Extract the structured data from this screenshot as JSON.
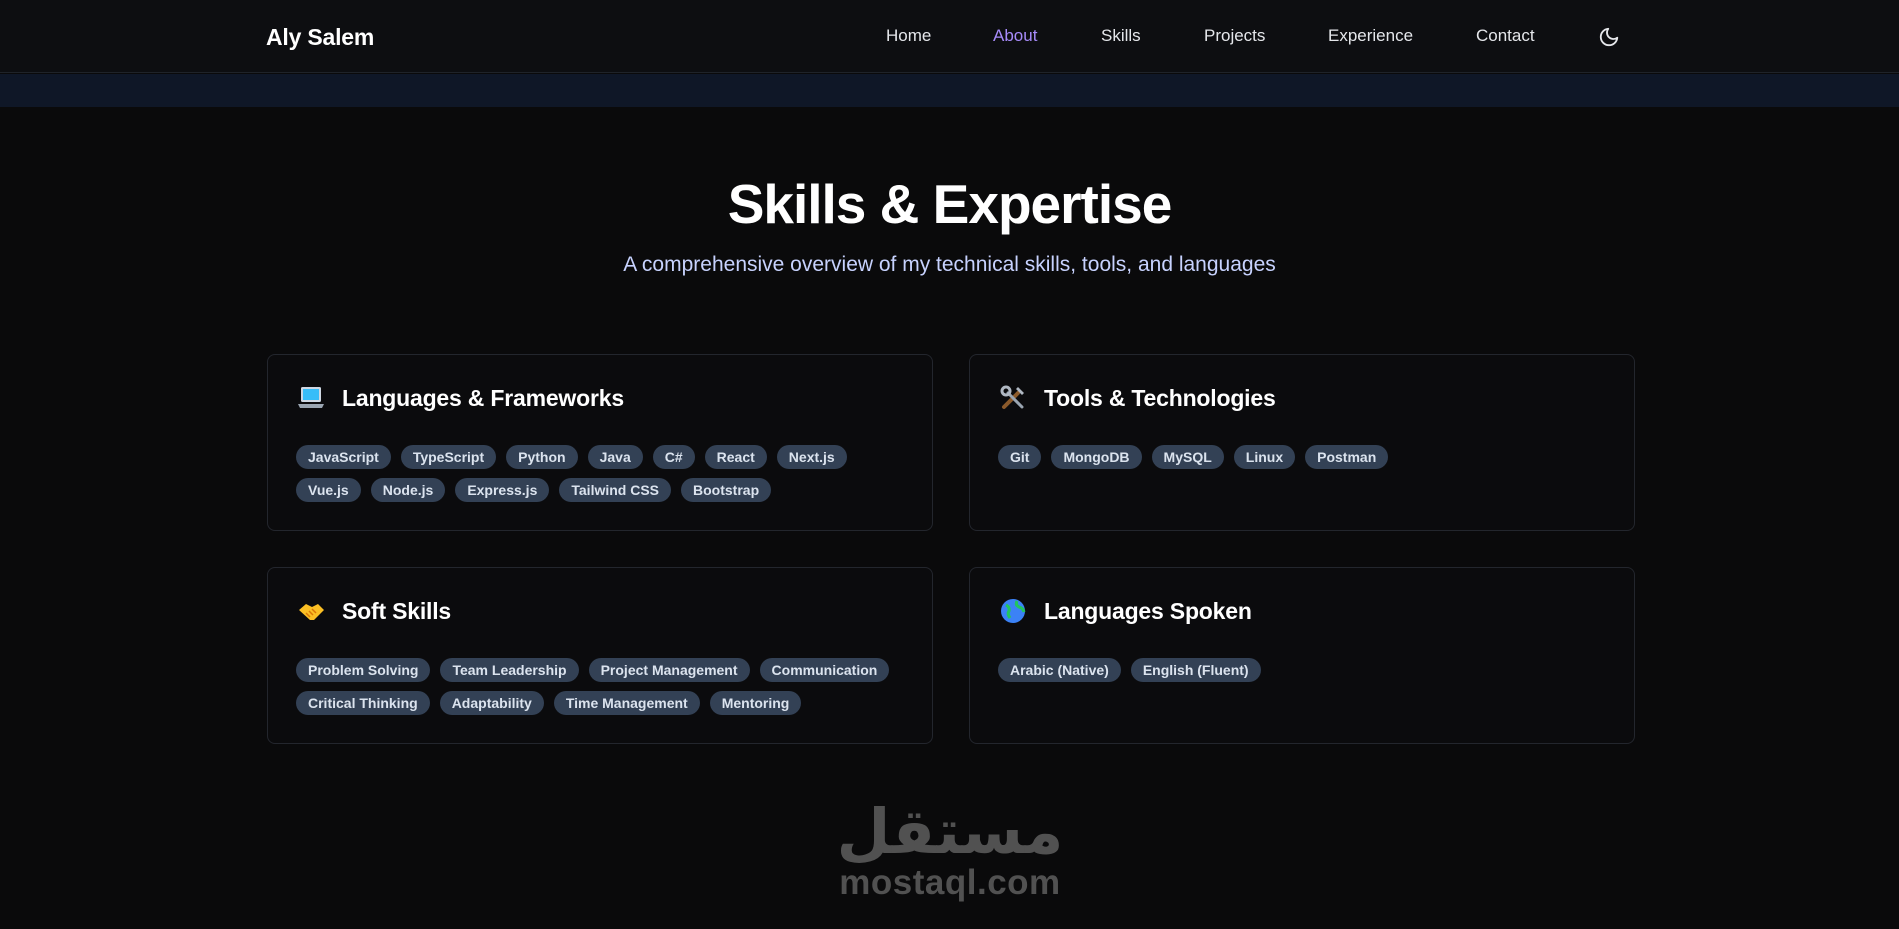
{
  "header": {
    "brand": "Aly Salem",
    "nav": [
      {
        "label": "Home",
        "active": false
      },
      {
        "label": "About",
        "active": true
      },
      {
        "label": "Skills",
        "active": false
      },
      {
        "label": "Projects",
        "active": false
      },
      {
        "label": "Experience",
        "active": false
      },
      {
        "label": "Contact",
        "active": false
      }
    ],
    "theme_icon": "moon-icon",
    "active_color": "#a78bfa"
  },
  "section": {
    "title": "Skills & Expertise",
    "subtitle": "A comprehensive overview of my technical skills, tools, and languages"
  },
  "cards": [
    {
      "icon": "laptop-icon",
      "title": "Languages & Frameworks",
      "tags": [
        "JavaScript",
        "TypeScript",
        "Python",
        "Java",
        "C#",
        "React",
        "Next.js",
        "Vue.js",
        "Node.js",
        "Express.js",
        "Tailwind CSS",
        "Bootstrap"
      ]
    },
    {
      "icon": "tools-icon",
      "title": "Tools & Technologies",
      "tags": [
        "Git",
        "MongoDB",
        "MySQL",
        "Linux",
        "Postman"
      ]
    },
    {
      "icon": "handshake-icon",
      "title": "Soft Skills",
      "tags": [
        "Problem Solving",
        "Team Leadership",
        "Project Management",
        "Communication",
        "Critical Thinking",
        "Adaptability",
        "Time Management",
        "Mentoring"
      ]
    },
    {
      "icon": "globe-icon",
      "title": "Languages Spoken",
      "tags": [
        "Arabic (Native)",
        "English (Fluent)"
      ]
    }
  ],
  "watermark": {
    "arabic": "مستقل",
    "latin": "mostaql.com"
  }
}
